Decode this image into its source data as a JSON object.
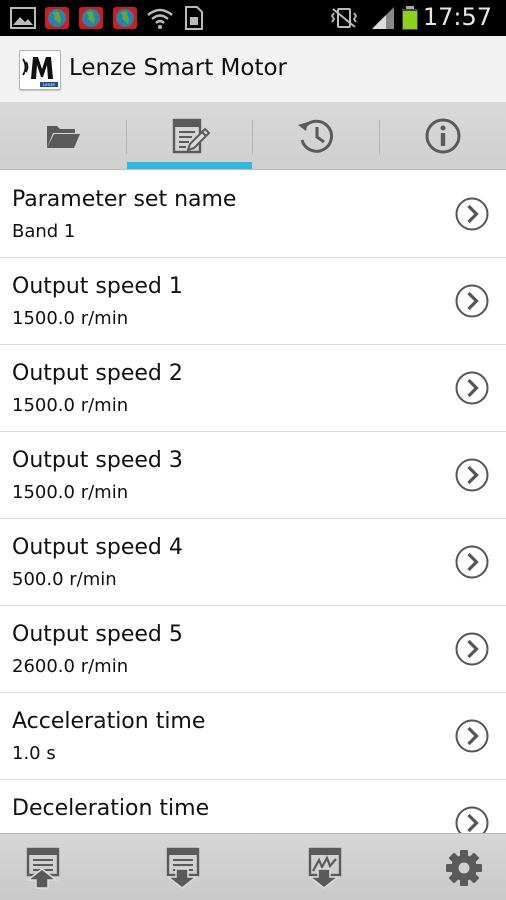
{
  "status_bar": {
    "time": "17:57",
    "battery_color": "#8ccf1e",
    "icons": [
      "image-notification-icon",
      "globe-icon",
      "globe-icon",
      "globe-icon",
      "wifi-icon",
      "sim-card-icon",
      "vibrate-icon",
      "signal-icon",
      "battery-icon"
    ]
  },
  "app_bar": {
    "title": "Lenze Smart Motor",
    "logo_letter": "M",
    "logo_brand": "Lenze"
  },
  "tabs": [
    {
      "icon": "folder-icon",
      "selected": false
    },
    {
      "icon": "edit-parameters-icon",
      "selected": true
    },
    {
      "icon": "history-clock-icon",
      "selected": false
    },
    {
      "icon": "info-icon",
      "selected": false
    }
  ],
  "accent_color": "#33b5e5",
  "parameters": [
    {
      "title": "Parameter set name",
      "value": "Band 1"
    },
    {
      "title": "Output speed 1",
      "value": "1500.0 r/min"
    },
    {
      "title": "Output speed 2",
      "value": "1500.0 r/min"
    },
    {
      "title": "Output speed 3",
      "value": "1500.0 r/min"
    },
    {
      "title": "Output speed 4",
      "value": "500.0 r/min"
    },
    {
      "title": "Output speed 5",
      "value": "2600.0 r/min"
    },
    {
      "title": "Acceleration time",
      "value": "1.0 s"
    },
    {
      "title": "Deceleration time",
      "value": ""
    }
  ],
  "bottom_bar": [
    {
      "icon": "upload-to-device-icon"
    },
    {
      "icon": "download-from-device-icon"
    },
    {
      "icon": "download-chart-icon"
    },
    {
      "icon": "settings-gear-icon"
    }
  ]
}
